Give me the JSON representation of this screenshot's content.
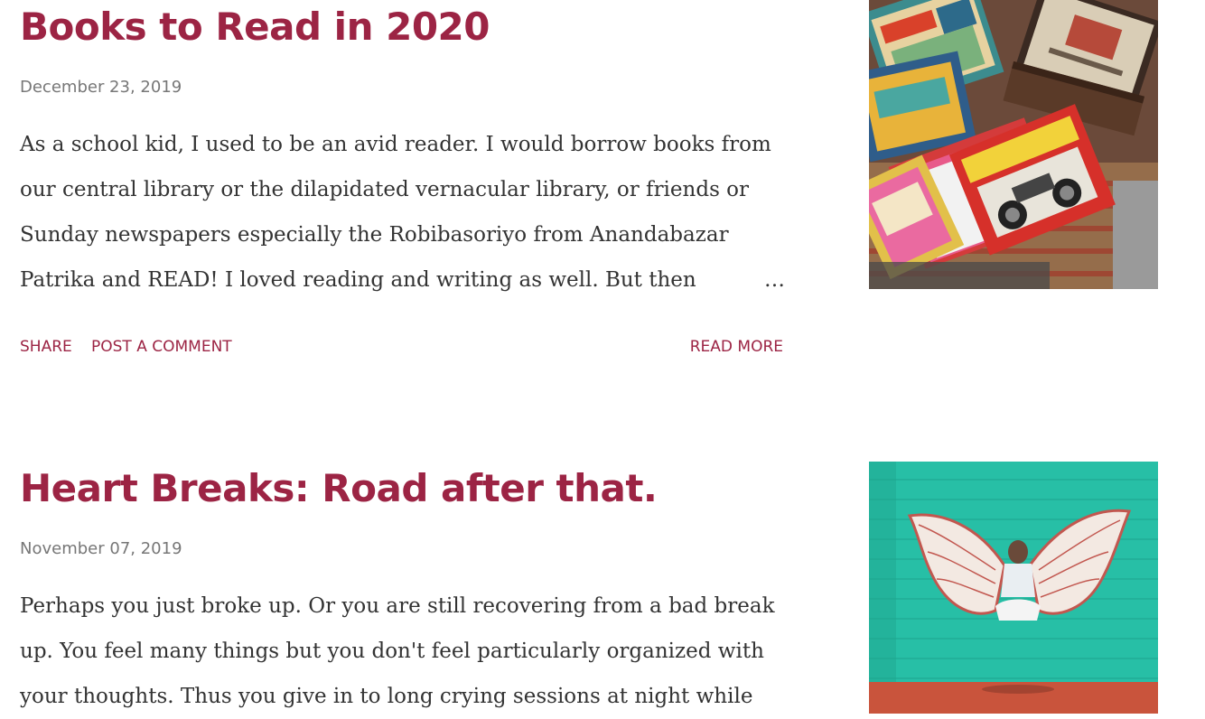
{
  "posts": [
    {
      "title": "Books to Read in 2020",
      "date": "December 23, 2019",
      "snippet_lines": [
        "As a school kid, I used to be an avid reader. I would borrow books from",
        "our central library or the dilapidated vernacular library, or friends or",
        "Sunday newspapers especially the Robibasoriyo from Anandabazar",
        "Patrika and READ! I loved reading and writing as well. But then"
      ],
      "ellipsis": "…",
      "actions": {
        "share": "SHARE",
        "comment": "POST A COMMENT",
        "read_more": "READ MORE"
      },
      "thumbnail_icon": "books-magazines-photo"
    },
    {
      "title": "Heart Breaks: Road after that.",
      "date": "November 07, 2019",
      "snippet_lines": [
        "Perhaps you just broke up. Or you are still recovering from a bad break",
        "up. You feel many things but you don't feel particularly organized with",
        "your thoughts. Thus you give in to long crying sessions at night while"
      ],
      "thumbnail_icon": "angel-wings-mural-photo"
    }
  ],
  "colors": {
    "accent": "#9c2444",
    "date": "#777777",
    "body_text": "#333333"
  }
}
